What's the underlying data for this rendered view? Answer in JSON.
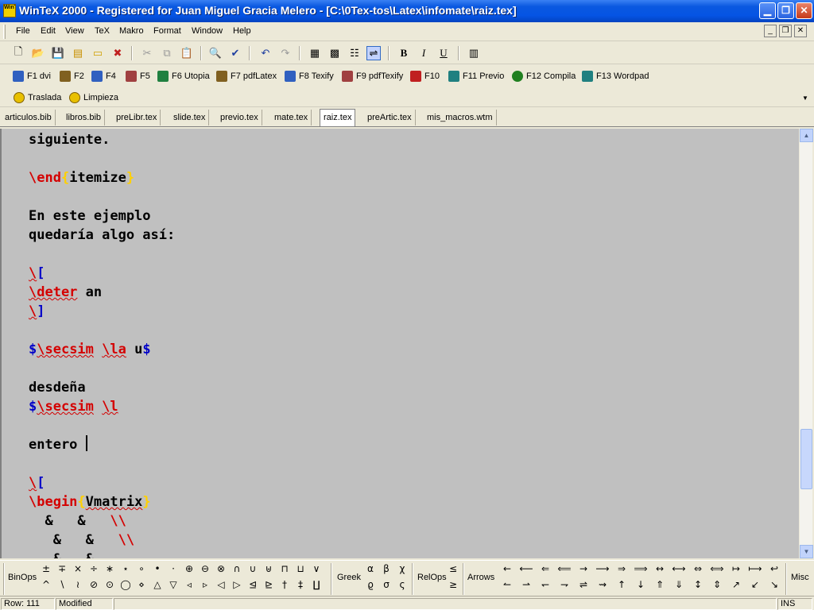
{
  "window": {
    "title": "WinTeX 2000 - Registered for Juan Miguel Gracia Melero - [C:\\0Tex-tos\\Latex\\infomate\\raiz.tex]",
    "app_icon_text": "WinTeX"
  },
  "menu": [
    "File",
    "Edit",
    "View",
    "TeX",
    "Makro",
    "Format",
    "Window",
    "Help"
  ],
  "toolbar": {
    "bold": "B",
    "italic": "I",
    "underline": "U"
  },
  "fkeys": [
    "F1 dvi",
    "F2",
    "F4",
    "F5",
    "F6 Utopia",
    "F7 pdfLatex",
    "F8 Texify",
    "F9 pdfTexify",
    "F10",
    "F11 Previo",
    "F12 Compila",
    "F13 Wordpad"
  ],
  "macros": [
    "Traslada",
    "Limpieza"
  ],
  "tabs": [
    "articulos.bib",
    "libros.bib",
    "preLibr.tex",
    "slide.tex",
    "previo.tex",
    "mate.tex",
    "raiz.tex",
    "preArtic.tex",
    "mis_macros.wtm"
  ],
  "active_tab": "raiz.tex",
  "editor": {
    "line1": "siguiente.",
    "end_cmd": "\\end",
    "end_arg": "itemize",
    "para1": "En este ejemplo",
    "para2": "quedaría algo así:",
    "open_bs": "\\",
    "open_br": "[",
    "deter_cmd": "\\deter",
    "deter_arg": " an",
    "close_bs": "\\",
    "close_br": "]",
    "dollar": "$",
    "secsim": "\\secsim",
    "la": "\\la",
    "u": " u",
    "desdena": "desdeña",
    "l": "\\l",
    "entero": "entero ",
    "begin_cmd": "\\begin",
    "begin_arg": "Vmatrix",
    "row1_amp": "  &   &   ",
    "row1_end": "\\\\",
    "row2_amp": "   &   &   ",
    "row2_end": "\\\\",
    "row3": "   &   &"
  },
  "symbolbar": {
    "binops_label": "BinOps",
    "binops_row1": [
      "±",
      "∓",
      "×",
      "÷",
      "∗",
      "⋆",
      "∘",
      "•",
      "·",
      "⊕",
      "⊖",
      "⊗",
      "∩",
      "∪",
      "⊎",
      "⊓",
      "⊔",
      "∨"
    ],
    "binops_row2": [
      "^",
      "∖",
      "≀",
      "⊘",
      "⊙",
      "◯",
      "⋄",
      "△",
      "▽",
      "◃",
      "▹",
      "◁",
      "▷",
      "⊴",
      "⊵",
      "†",
      "‡",
      "∐"
    ],
    "greek_label": "Greek",
    "greek_row1": [
      "α",
      "β",
      "χ"
    ],
    "greek_row2": [
      "ϱ",
      "σ",
      "ς"
    ],
    "relops_label": "RelOps",
    "relops_row1": [
      "≤"
    ],
    "relops_row2": [
      "≥"
    ],
    "arrows_label": "Arrows",
    "arrows_row1": [
      "←",
      "⟵",
      "⇐",
      "⟸",
      "→",
      "⟶",
      "⇒",
      "⟹",
      "↔",
      "⟷",
      "⇔",
      "⟺",
      "↦",
      "⟼",
      "↩"
    ],
    "arrows_row2": [
      "↼",
      "⇀",
      "↽",
      "⇁",
      "⇌",
      "⇝",
      "↑",
      "↓",
      "⇑",
      "⇓",
      "↕",
      "⇕",
      "↗",
      "↙",
      "↘"
    ],
    "misc_label": "Misc"
  },
  "status": {
    "row": "Row: 111",
    "modified": "Modified",
    "ins": "INS"
  }
}
